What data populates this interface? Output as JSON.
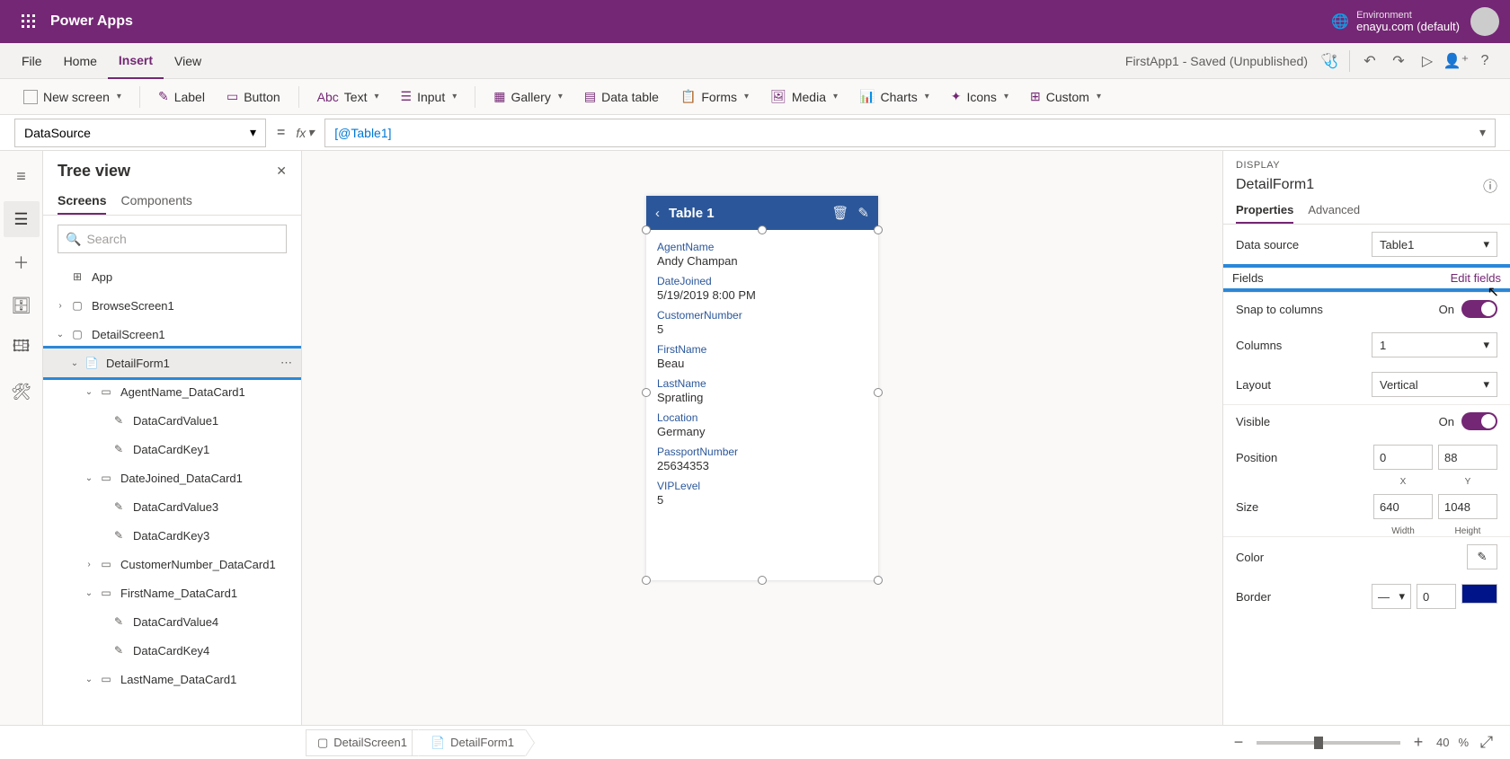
{
  "header": {
    "product": "Power Apps",
    "env_label": "Environment",
    "env_name": "enayu.com (default)"
  },
  "menu": {
    "items": [
      "File",
      "Home",
      "Insert",
      "View"
    ],
    "active": "Insert",
    "app_status": "FirstApp1 - Saved (Unpublished)"
  },
  "ribbon": {
    "new_screen": "New screen",
    "label": "Label",
    "button": "Button",
    "text": "Text",
    "input": "Input",
    "gallery": "Gallery",
    "datatable": "Data table",
    "forms": "Forms",
    "media": "Media",
    "charts": "Charts",
    "icons": "Icons",
    "custom": "Custom"
  },
  "formula": {
    "property": "DataSource",
    "value": "[@Table1]"
  },
  "tree": {
    "title": "Tree view",
    "tabs": {
      "screens": "Screens",
      "components": "Components"
    },
    "search_placeholder": "Search",
    "nodes": {
      "app": "App",
      "browse": "BrowseScreen1",
      "detail_screen": "DetailScreen1",
      "detail_form": "DetailForm1",
      "agent_dc": "AgentName_DataCard1",
      "dcv1": "DataCardValue1",
      "dck1": "DataCardKey1",
      "date_dc": "DateJoined_DataCard1",
      "dcv3": "DataCardValue3",
      "dck3": "DataCardKey3",
      "cust_dc": "CustomerNumber_DataCard1",
      "first_dc": "FirstName_DataCard1",
      "dcv4": "DataCardValue4",
      "dck4": "DataCardKey4",
      "last_dc": "LastName_DataCard1"
    }
  },
  "canvas": {
    "form_title": "Table 1",
    "cards": [
      {
        "label": "AgentName",
        "value": "Andy Champan"
      },
      {
        "label": "DateJoined",
        "value": "5/19/2019 8:00 PM"
      },
      {
        "label": "CustomerNumber",
        "value": "5"
      },
      {
        "label": "FirstName",
        "value": "Beau"
      },
      {
        "label": "LastName",
        "value": "Spratling"
      },
      {
        "label": "Location",
        "value": "Germany"
      },
      {
        "label": "PassportNumber",
        "value": "25634353"
      },
      {
        "label": "VIPLevel",
        "value": "5"
      }
    ]
  },
  "props": {
    "kicker": "DISPLAY",
    "title": "DetailForm1",
    "tabs": {
      "properties": "Properties",
      "advanced": "Advanced"
    },
    "data_source_label": "Data source",
    "data_source_value": "Table1",
    "fields_label": "Fields",
    "edit_fields": "Edit fields",
    "snap_label": "Snap to columns",
    "snap_value": "On",
    "columns_label": "Columns",
    "columns_value": "1",
    "layout_label": "Layout",
    "layout_value": "Vertical",
    "visible_label": "Visible",
    "visible_value": "On",
    "position_label": "Position",
    "pos_x": "0",
    "pos_y": "88",
    "x_label": "X",
    "y_label": "Y",
    "size_label": "Size",
    "width": "640",
    "height": "1048",
    "w_label": "Width",
    "h_label": "Height",
    "color_label": "Color",
    "border_label": "Border",
    "border_width": "0"
  },
  "status": {
    "crumb1": "DetailScreen1",
    "crumb2": "DetailForm1",
    "zoom": "40",
    "pct": "%"
  }
}
